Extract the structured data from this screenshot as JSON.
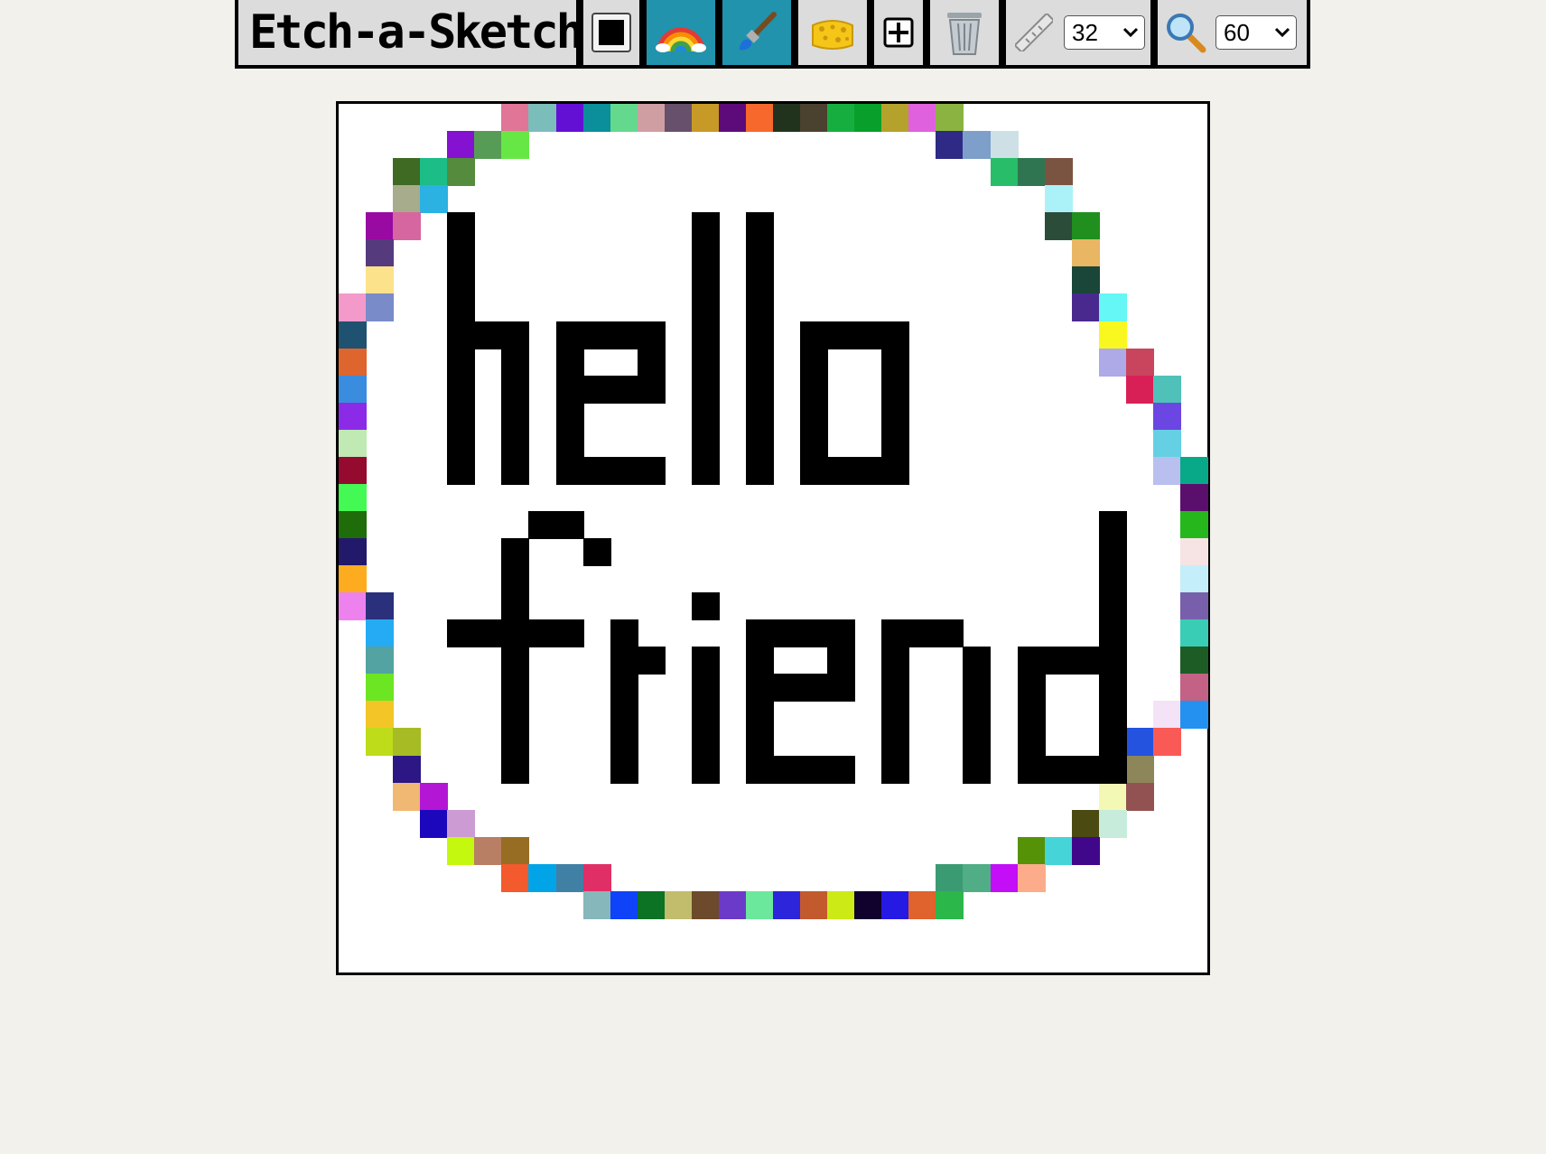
{
  "app": {
    "title": "Etch-a-Sketch"
  },
  "toolbar": {
    "color_picker": {
      "value": "#000000"
    },
    "rainbow_icon": "rainbow-icon",
    "brush_icon": "paintbrush-icon",
    "eraser_icon": "sponge-icon",
    "grid_icon": "grid-toggle-icon",
    "clear_icon": "wastebasket-icon",
    "size": {
      "icon": "ruler-icon",
      "value": "32"
    },
    "zoom": {
      "icon": "magnifier-icon",
      "value": "60"
    },
    "active_mode_color": "#2193ad"
  },
  "canvas": {
    "grid_size": 32,
    "background": "#ffffff",
    "ink": "#000000",
    "black_cells": [
      [
        4,
        4
      ],
      [
        4,
        5
      ],
      [
        4,
        6
      ],
      [
        4,
        7
      ],
      [
        4,
        8
      ],
      [
        4,
        9
      ],
      [
        4,
        10
      ],
      [
        4,
        11
      ],
      [
        4,
        12
      ],
      [
        4,
        13
      ],
      [
        5,
        8
      ],
      [
        6,
        8
      ],
      [
        6,
        9
      ],
      [
        6,
        10
      ],
      [
        6,
        11
      ],
      [
        6,
        12
      ],
      [
        6,
        13
      ],
      [
        8,
        8
      ],
      [
        8,
        9
      ],
      [
        8,
        10
      ],
      [
        8,
        11
      ],
      [
        8,
        12
      ],
      [
        8,
        13
      ],
      [
        9,
        8
      ],
      [
        10,
        8
      ],
      [
        11,
        8
      ],
      [
        9,
        10
      ],
      [
        10,
        10
      ],
      [
        11,
        10
      ],
      [
        9,
        13
      ],
      [
        10,
        13
      ],
      [
        11,
        13
      ],
      [
        11,
        9
      ],
      [
        13,
        4
      ],
      [
        13,
        5
      ],
      [
        13,
        6
      ],
      [
        13,
        7
      ],
      [
        13,
        8
      ],
      [
        13,
        9
      ],
      [
        13,
        10
      ],
      [
        13,
        11
      ],
      [
        13,
        12
      ],
      [
        13,
        13
      ],
      [
        15,
        4
      ],
      [
        15,
        5
      ],
      [
        15,
        6
      ],
      [
        15,
        7
      ],
      [
        15,
        8
      ],
      [
        15,
        9
      ],
      [
        15,
        10
      ],
      [
        15,
        11
      ],
      [
        15,
        12
      ],
      [
        15,
        13
      ],
      [
        17,
        8
      ],
      [
        17,
        9
      ],
      [
        17,
        10
      ],
      [
        17,
        11
      ],
      [
        17,
        12
      ],
      [
        17,
        13
      ],
      [
        18,
        8
      ],
      [
        19,
        8
      ],
      [
        20,
        8
      ],
      [
        18,
        13
      ],
      [
        19,
        13
      ],
      [
        20,
        13
      ],
      [
        20,
        9
      ],
      [
        20,
        10
      ],
      [
        20,
        11
      ],
      [
        20,
        12
      ],
      [
        7,
        15
      ],
      [
        8,
        15
      ],
      [
        9,
        16
      ],
      [
        6,
        16
      ],
      [
        6,
        17
      ],
      [
        6,
        18
      ],
      [
        6,
        19
      ],
      [
        6,
        20
      ],
      [
        6,
        21
      ],
      [
        6,
        22
      ],
      [
        6,
        23
      ],
      [
        6,
        24
      ],
      [
        4,
        19
      ],
      [
        5,
        19
      ],
      [
        7,
        19
      ],
      [
        8,
        19
      ],
      [
        10,
        19
      ],
      [
        10,
        20
      ],
      [
        10,
        21
      ],
      [
        10,
        22
      ],
      [
        10,
        23
      ],
      [
        10,
        24
      ],
      [
        11,
        20
      ],
      [
        13,
        18
      ],
      [
        13,
        20
      ],
      [
        13,
        21
      ],
      [
        13,
        22
      ],
      [
        13,
        23
      ],
      [
        13,
        24
      ],
      [
        15,
        19
      ],
      [
        15,
        20
      ],
      [
        15,
        21
      ],
      [
        15,
        22
      ],
      [
        15,
        23
      ],
      [
        15,
        24
      ],
      [
        16,
        19
      ],
      [
        17,
        19
      ],
      [
        18,
        19
      ],
      [
        18,
        20
      ],
      [
        18,
        21
      ],
      [
        16,
        21
      ],
      [
        17,
        21
      ],
      [
        16,
        24
      ],
      [
        17,
        24
      ],
      [
        18,
        24
      ],
      [
        20,
        19
      ],
      [
        20,
        20
      ],
      [
        20,
        21
      ],
      [
        20,
        22
      ],
      [
        20,
        23
      ],
      [
        20,
        24
      ],
      [
        21,
        19
      ],
      [
        22,
        19
      ],
      [
        23,
        20
      ],
      [
        23,
        21
      ],
      [
        23,
        22
      ],
      [
        23,
        23
      ],
      [
        23,
        24
      ],
      [
        25,
        20
      ],
      [
        25,
        21
      ],
      [
        25,
        22
      ],
      [
        25,
        23
      ],
      [
        25,
        24
      ],
      [
        26,
        20
      ],
      [
        27,
        20
      ],
      [
        26,
        24
      ],
      [
        27,
        24
      ],
      [
        28,
        15
      ],
      [
        28,
        16
      ],
      [
        28,
        17
      ],
      [
        28,
        18
      ],
      [
        28,
        19
      ],
      [
        28,
        20
      ],
      [
        28,
        21
      ],
      [
        28,
        22
      ],
      [
        28,
        23
      ],
      [
        28,
        24
      ]
    ],
    "ring_cells": [
      [
        6,
        0,
        "#e07598"
      ],
      [
        7,
        0,
        "#7bbdbb"
      ],
      [
        8,
        0,
        "#6410d4"
      ],
      [
        9,
        0,
        "#0b8f9b"
      ],
      [
        10,
        0,
        "#64d98d"
      ],
      [
        11,
        0,
        "#cf9ea3"
      ],
      [
        12,
        0,
        "#67506b"
      ],
      [
        13,
        0,
        "#c79a27"
      ],
      [
        14,
        0,
        "#5d0b7a"
      ],
      [
        15,
        0,
        "#f6682b"
      ],
      [
        16,
        0,
        "#21331d"
      ],
      [
        17,
        0,
        "#4a412f"
      ],
      [
        18,
        0,
        "#17ae40"
      ],
      [
        19,
        0,
        "#08a02a"
      ],
      [
        20,
        0,
        "#b5a22c"
      ],
      [
        21,
        0,
        "#df61dd"
      ],
      [
        22,
        0,
        "#8ab341"
      ],
      [
        4,
        1,
        "#8511d1"
      ],
      [
        5,
        1,
        "#579c56"
      ],
      [
        6,
        1,
        "#66e746"
      ],
      [
        22,
        1,
        "#2e2a86"
      ],
      [
        23,
        1,
        "#7e9fca"
      ],
      [
        24,
        1,
        "#cde0e6"
      ],
      [
        2,
        2,
        "#3e6a23"
      ],
      [
        3,
        2,
        "#1cbd86"
      ],
      [
        4,
        2,
        "#558b3c"
      ],
      [
        24,
        2,
        "#28bd68"
      ],
      [
        25,
        2,
        "#2f7552"
      ],
      [
        26,
        2,
        "#7b5441"
      ],
      [
        2,
        3,
        "#a6ac8c"
      ],
      [
        3,
        3,
        "#2bb1e2"
      ],
      [
        26,
        3,
        "#abf2f8"
      ],
      [
        1,
        4,
        "#980aa2"
      ],
      [
        2,
        4,
        "#d6669f"
      ],
      [
        26,
        4,
        "#2c4c3a"
      ],
      [
        27,
        4,
        "#208f1d"
      ],
      [
        1,
        5,
        "#563a7e"
      ],
      [
        27,
        5,
        "#e9b663"
      ],
      [
        1,
        6,
        "#fbe28b"
      ],
      [
        27,
        6,
        "#1a463a"
      ],
      [
        0,
        7,
        "#f49acb"
      ],
      [
        1,
        7,
        "#7a8bc9"
      ],
      [
        27,
        7,
        "#4a298f"
      ],
      [
        28,
        7,
        "#64f7f5"
      ],
      [
        0,
        8,
        "#1f5271"
      ],
      [
        28,
        8,
        "#f8f820"
      ],
      [
        0,
        9,
        "#de652d"
      ],
      [
        28,
        9,
        "#adaae7"
      ],
      [
        29,
        9,
        "#c9455e"
      ],
      [
        0,
        10,
        "#3a8cde"
      ],
      [
        29,
        10,
        "#d82057"
      ],
      [
        30,
        10,
        "#50c1b9"
      ],
      [
        0,
        11,
        "#8b2be8"
      ],
      [
        30,
        11,
        "#6c46e2"
      ],
      [
        0,
        12,
        "#c0e9b4"
      ],
      [
        30,
        12,
        "#65d0e3"
      ],
      [
        0,
        13,
        "#950b30"
      ],
      [
        30,
        13,
        "#b9bfee"
      ],
      [
        31,
        13,
        "#07a989"
      ],
      [
        0,
        14,
        "#45f954"
      ],
      [
        31,
        14,
        "#5b0f6d"
      ],
      [
        0,
        15,
        "#1f6d0a"
      ],
      [
        31,
        15,
        "#25b71c"
      ],
      [
        0,
        16,
        "#22196b"
      ],
      [
        31,
        16,
        "#f6e4e4"
      ],
      [
        0,
        17,
        "#fdac20"
      ],
      [
        31,
        17,
        "#c4eef9"
      ],
      [
        0,
        18,
        "#ed82ef"
      ],
      [
        1,
        18,
        "#2a307c"
      ],
      [
        31,
        18,
        "#775fab"
      ],
      [
        1,
        19,
        "#24abf4"
      ],
      [
        31,
        19,
        "#38cdb4"
      ],
      [
        1,
        20,
        "#52a3a1"
      ],
      [
        31,
        20,
        "#1d5c25"
      ],
      [
        1,
        21,
        "#6ce523"
      ],
      [
        31,
        21,
        "#c36284"
      ],
      [
        1,
        22,
        "#f3c526"
      ],
      [
        30,
        22,
        "#f4e2f7"
      ],
      [
        31,
        22,
        "#2491f0"
      ],
      [
        1,
        23,
        "#bedc1a"
      ],
      [
        2,
        23,
        "#a7bb25"
      ],
      [
        29,
        23,
        "#2453e0"
      ],
      [
        30,
        23,
        "#fa5a55"
      ],
      [
        2,
        24,
        "#2c1784"
      ],
      [
        29,
        24,
        "#8d865a"
      ],
      [
        2,
        25,
        "#f0b873"
      ],
      [
        3,
        25,
        "#b416d5"
      ],
      [
        28,
        25,
        "#f3f9b4"
      ],
      [
        29,
        25,
        "#935252"
      ],
      [
        3,
        26,
        "#1c07bd"
      ],
      [
        4,
        26,
        "#cd9bd4"
      ],
      [
        27,
        26,
        "#4b4a11"
      ],
      [
        28,
        26,
        "#c7ecdc"
      ],
      [
        4,
        27,
        "#c4f80f"
      ],
      [
        5,
        27,
        "#b97f64"
      ],
      [
        6,
        27,
        "#966d23"
      ],
      [
        25,
        27,
        "#559208"
      ],
      [
        26,
        27,
        "#45d4d8"
      ],
      [
        27,
        27,
        "#41078a"
      ],
      [
        6,
        28,
        "#f35a2d"
      ],
      [
        7,
        28,
        "#01a5e7"
      ],
      [
        8,
        28,
        "#4180a5"
      ],
      [
        9,
        28,
        "#e02e66"
      ],
      [
        22,
        28,
        "#3a9b72"
      ],
      [
        23,
        28,
        "#50ad85"
      ],
      [
        24,
        28,
        "#c30ef7"
      ],
      [
        25,
        28,
        "#fcac8b"
      ],
      [
        9,
        29,
        "#85b7bb"
      ],
      [
        10,
        29,
        "#0e43fa"
      ],
      [
        11,
        29,
        "#0c7224"
      ],
      [
        12,
        29,
        "#c1bd6d"
      ],
      [
        13,
        29,
        "#6c4a2b"
      ],
      [
        14,
        29,
        "#6b3ac9"
      ],
      [
        15,
        29,
        "#6be89c"
      ],
      [
        16,
        29,
        "#2d25db"
      ],
      [
        17,
        29,
        "#c35a2e"
      ],
      [
        18,
        29,
        "#ccea15"
      ],
      [
        19,
        29,
        "#10012d"
      ],
      [
        20,
        29,
        "#2519e4"
      ],
      [
        21,
        29,
        "#e0622c"
      ],
      [
        22,
        29,
        "#2bb749"
      ]
    ]
  }
}
